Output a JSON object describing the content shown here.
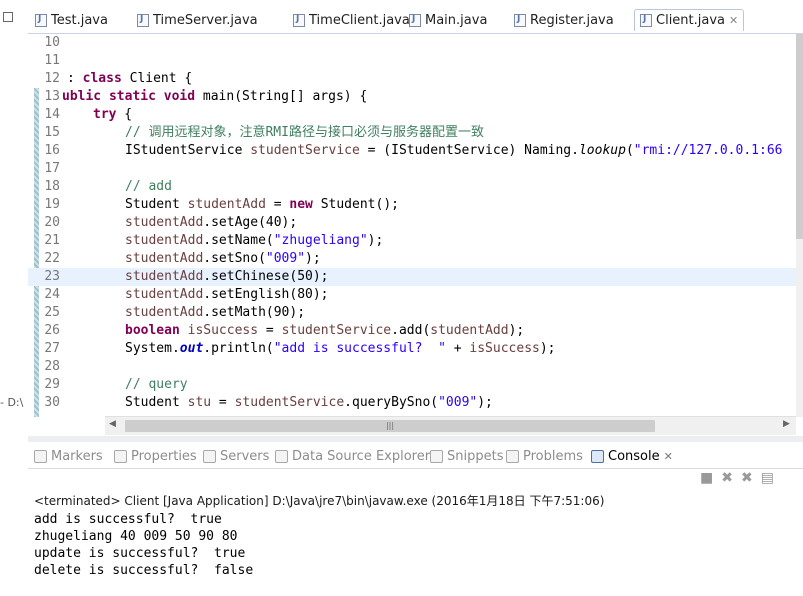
{
  "left_strip": {
    "text": "- D:\\"
  },
  "tabs": [
    {
      "label": "Test.java"
    },
    {
      "label": "TimeServer.java"
    },
    {
      "label": "TimeClient.java"
    },
    {
      "label": "Main.java"
    },
    {
      "label": "Register.java"
    },
    {
      "label": "Client.java",
      "active": true
    }
  ],
  "editor": {
    "lines": [
      {
        "n": "10"
      },
      {
        "n": "11"
      },
      {
        "n": "12"
      },
      {
        "n": "13"
      },
      {
        "n": "14"
      },
      {
        "n": "15"
      },
      {
        "n": "16"
      },
      {
        "n": "17"
      },
      {
        "n": "18"
      },
      {
        "n": "19"
      },
      {
        "n": "20"
      },
      {
        "n": "21"
      },
      {
        "n": "22"
      },
      {
        "n": "23"
      },
      {
        "n": "24"
      },
      {
        "n": "25"
      },
      {
        "n": "26"
      },
      {
        "n": "27"
      },
      {
        "n": "28"
      },
      {
        "n": "29"
      },
      {
        "n": "30"
      }
    ],
    "code": {
      "l12": {
        "kw": "class",
        "rest": " Client {",
        "prefix": ": "
      },
      "l13": {
        "prefix": "ublic",
        "kw1": " static",
        "kw2": " void",
        "rest": " main(String[] args) {"
      },
      "l14": {
        "kw": "try",
        "rest": " {"
      },
      "l15": {
        "comment": "// 调用远程对象，注意RMI路径与接口必须与服务器配置一致"
      },
      "l16": {
        "a": "IStudentService ",
        "var": "studentService",
        "b": " = (IStudentService) Naming.",
        "m": "lookup",
        "c": "(",
        "s": "\"rmi://127.0.0.1:66"
      },
      "l18": {
        "comment": "// add"
      },
      "l19": {
        "a": "Student ",
        "var": "studentAdd",
        "b": " = ",
        "kw": "new",
        "c": " Student();"
      },
      "l20": {
        "var": "studentAdd",
        "b": ".setAge(40);"
      },
      "l21": {
        "var": "studentAdd",
        "b": ".setName(",
        "s": "\"zhugeliang\"",
        "c": ");"
      },
      "l22": {
        "var": "studentAdd",
        "b": ".setSno(",
        "s": "\"009\"",
        "c": ");"
      },
      "l23": {
        "var": "studentAdd",
        "b": ".setChinese(50);"
      },
      "l24": {
        "var": "studentAdd",
        "b": ".setEnglish(80);"
      },
      "l25": {
        "var": "studentAdd",
        "b": ".setMath(90);"
      },
      "l26": {
        "kw": "boolean",
        "a": " ",
        "var": "isSuccess",
        "b": " = ",
        "var2": "studentService",
        "c": ".add(",
        "var3": "studentAdd",
        "d": ");"
      },
      "l27": {
        "a": "System.",
        "f": "out",
        "b": ".println(",
        "s": "\"add is successful?  \"",
        "c": " + ",
        "var": "isSuccess",
        "d": ");"
      },
      "l29": {
        "comment": "// query"
      },
      "l30": {
        "a": "Student ",
        "var": "stu",
        "b": " = ",
        "var2": "studentService",
        "c": ".queryBySno(",
        "s": "\"009\"",
        "d": ");"
      }
    }
  },
  "views": [
    {
      "label": "Markers"
    },
    {
      "label": "Properties"
    },
    {
      "label": "Servers"
    },
    {
      "label": "Data Source Explorer"
    },
    {
      "label": "Snippets"
    },
    {
      "label": "Problems"
    },
    {
      "label": "Console",
      "active": true
    }
  ],
  "console": {
    "status": "<terminated> Client [Java Application] D:\\Java\\jre7\\bin\\javaw.exe (2016年1月18日 下午7:51:06)",
    "output": [
      "add is successful?  true",
      "zhugeliang 40 009 50 90 80",
      "update is successful?  true",
      "delete is successful?  false"
    ]
  }
}
